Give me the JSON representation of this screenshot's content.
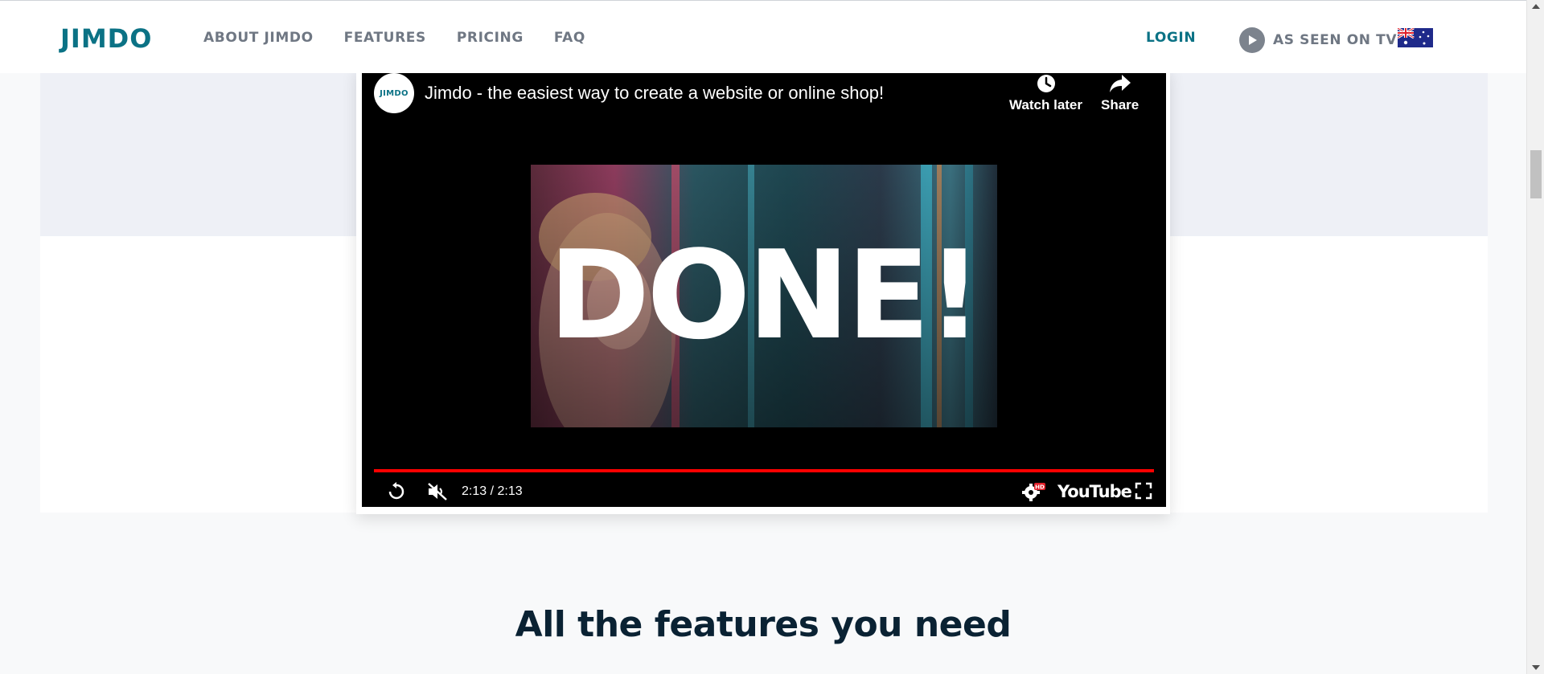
{
  "nav": {
    "logo": "JIMDO",
    "links": [
      "ABOUT JIMDO",
      "FEATURES",
      "PRICING",
      "FAQ"
    ],
    "login": "LOGIN",
    "tv_label": "AS SEEN ON TV",
    "flag": "australia-flag-icon"
  },
  "video": {
    "channel_logo": "JIMDO",
    "title": "Jimdo - the easiest way to create a website or online shop!",
    "watch_later": "Watch later",
    "share": "Share",
    "thumbnail_text": "DONE!",
    "time": "2:13 / 2:13",
    "progress": 1.0,
    "youtube_label": "YouTube",
    "hd_badge": "HD"
  },
  "main": {
    "features_heading": "All the features you need"
  },
  "colors": {
    "brand": "#0b7285",
    "nav_text": "#6f7783",
    "progress": "#ff0000",
    "heading": "#0a2233",
    "band": "#eef0f6"
  }
}
